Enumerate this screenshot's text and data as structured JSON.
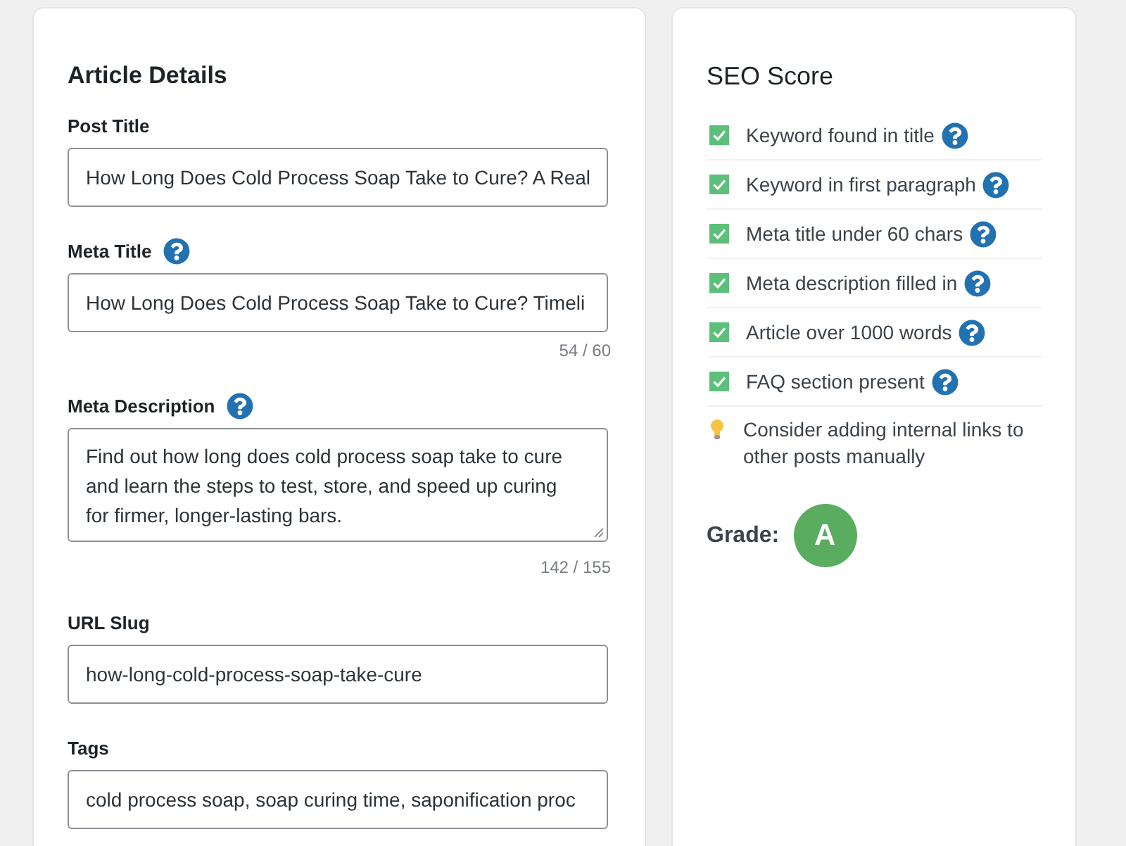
{
  "article_details": {
    "title": "Article Details",
    "fields": [
      {
        "label": "Post Title",
        "kind": "input",
        "help": false,
        "value": "How Long Does Cold Process Soap Take to Cure? A Real"
      },
      {
        "label": "Meta Title",
        "kind": "input",
        "help": true,
        "value": "How Long Does Cold Process Soap Take to Cure? Timeli",
        "counter": "54 / 60"
      },
      {
        "label": "Meta Description",
        "kind": "textarea",
        "help": true,
        "value": "Find out how long does cold process soap take to cure and learn the steps to test, store, and speed up curing for firmer, longer-lasting bars.",
        "counter": "142 / 155"
      },
      {
        "label": "URL Slug",
        "kind": "input",
        "help": false,
        "value": "how-long-cold-process-soap-take-cure"
      },
      {
        "label": "Tags",
        "kind": "input",
        "help": false,
        "value": "cold process soap, soap curing time, saponification proc"
      }
    ]
  },
  "seo_score": {
    "title": "SEO Score",
    "checks": [
      {
        "kind": "check",
        "label": "Keyword found in title",
        "checked": true,
        "help": true
      },
      {
        "kind": "check",
        "label": "Keyword in first paragraph",
        "checked": true,
        "help": true
      },
      {
        "kind": "check",
        "label": "Meta title under 60 chars",
        "checked": true,
        "help": true
      },
      {
        "kind": "check",
        "label": "Meta description filled in",
        "checked": true,
        "help": true
      },
      {
        "kind": "check",
        "label": "Article over 1000 words",
        "checked": true,
        "help": true
      },
      {
        "kind": "check",
        "label": "FAQ section present",
        "checked": true,
        "help": true
      },
      {
        "kind": "tip",
        "label": "Consider adding internal links to other posts manually",
        "help": false
      }
    ],
    "grade": {
      "label": "Grade:",
      "value": "A"
    }
  }
}
